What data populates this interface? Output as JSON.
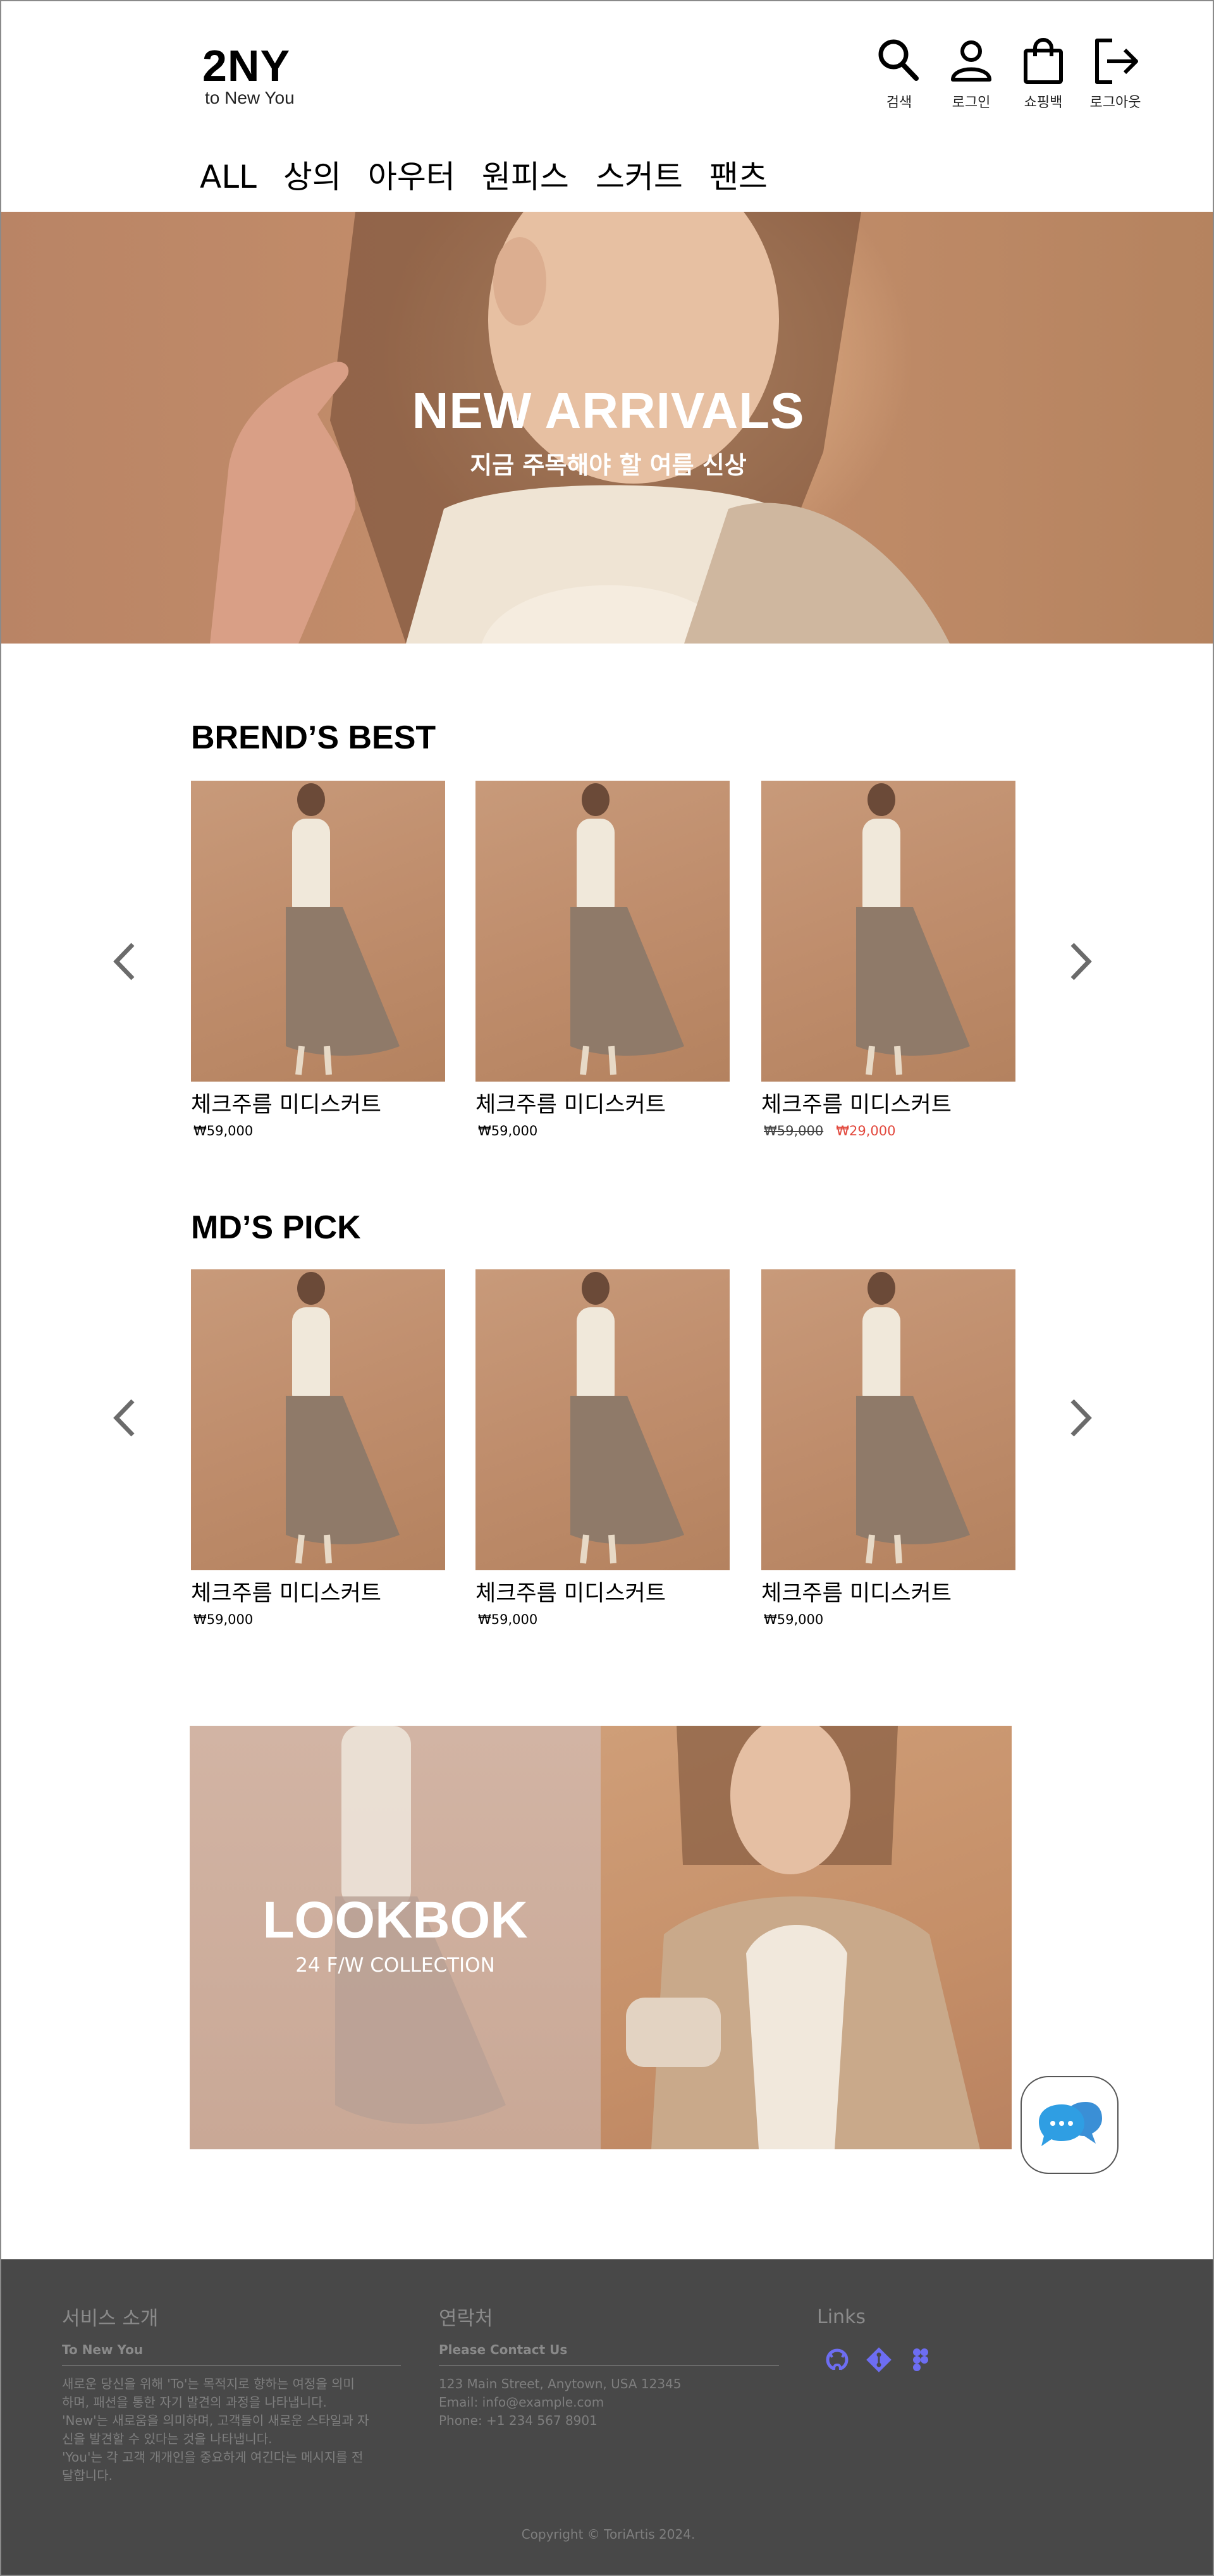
{
  "header": {
    "logo": "2NY",
    "tagline": "to New You",
    "icons": [
      {
        "label": "검색",
        "icon": "search-icon"
      },
      {
        "label": "로그인",
        "icon": "user-icon"
      },
      {
        "label": "쇼핑백",
        "icon": "shopping-bag-icon"
      },
      {
        "label": "로그아웃",
        "icon": "logout-icon"
      }
    ]
  },
  "nav": [
    "ALL",
    "상의",
    "아우터",
    "원피스",
    "스커트",
    "팬츠"
  ],
  "hero": {
    "title": "NEW ARRIVALS",
    "subtitle": "지금 주목해야 할 여름 신상"
  },
  "best": {
    "title": "BREND’S BEST",
    "items": [
      {
        "name": "체크주름 미디스커트",
        "price": "₩59,000"
      },
      {
        "name": "체크주름 미디스커트",
        "price": "₩59,000"
      },
      {
        "name": "체크주름 미디스커트",
        "original_price": "₩59,000",
        "sale_price": "₩29,000"
      }
    ]
  },
  "md": {
    "title": "MD’S PICK",
    "items": [
      {
        "name": "체크주름 미디스커트",
        "price": "₩59,000"
      },
      {
        "name": "체크주름 미디스커트",
        "price": "₩59,000"
      },
      {
        "name": "체크주름 미디스커트",
        "price": "₩59,000"
      }
    ]
  },
  "lookbook": {
    "title": "LOOKBOK",
    "subtitle": "24 F/W COLLECTION"
  },
  "footer": {
    "about": {
      "title": "서비스 소개",
      "subtitle": "To New You",
      "lines": [
        "새로운 당신을 위해 'To'는 목적지로 향하는 여정을 의미",
        "하며, 패션을 통한 자기 발견의 과정을 나타냅니다.",
        "'New'는 새로움을 의미하며, 고객들이 새로운 스타일과 자",
        "신을 발견할 수 있다는 것을 나타냅니다.",
        "'You'는 각 고객 개개인을 중요하게 여긴다는 메시지를 전",
        "달합니다."
      ]
    },
    "contact": {
      "title": "연락처",
      "subtitle": "Please Contact Us",
      "address": "123 Main Street, Anytown, USA 12345",
      "email": "Email: info@example.com",
      "phone": "Phone: +1 234 567 8901"
    },
    "links": {
      "title": "Links",
      "icons": [
        "github-icon",
        "git-icon",
        "figma-icon"
      ]
    },
    "copyright": "Copyright © ToriArtis 2024."
  },
  "colors": {
    "sale": "#e2483d",
    "footer_bg": "#484848",
    "link_icon": "#6d6df2",
    "chat_bubble": "#2f9ee3"
  }
}
